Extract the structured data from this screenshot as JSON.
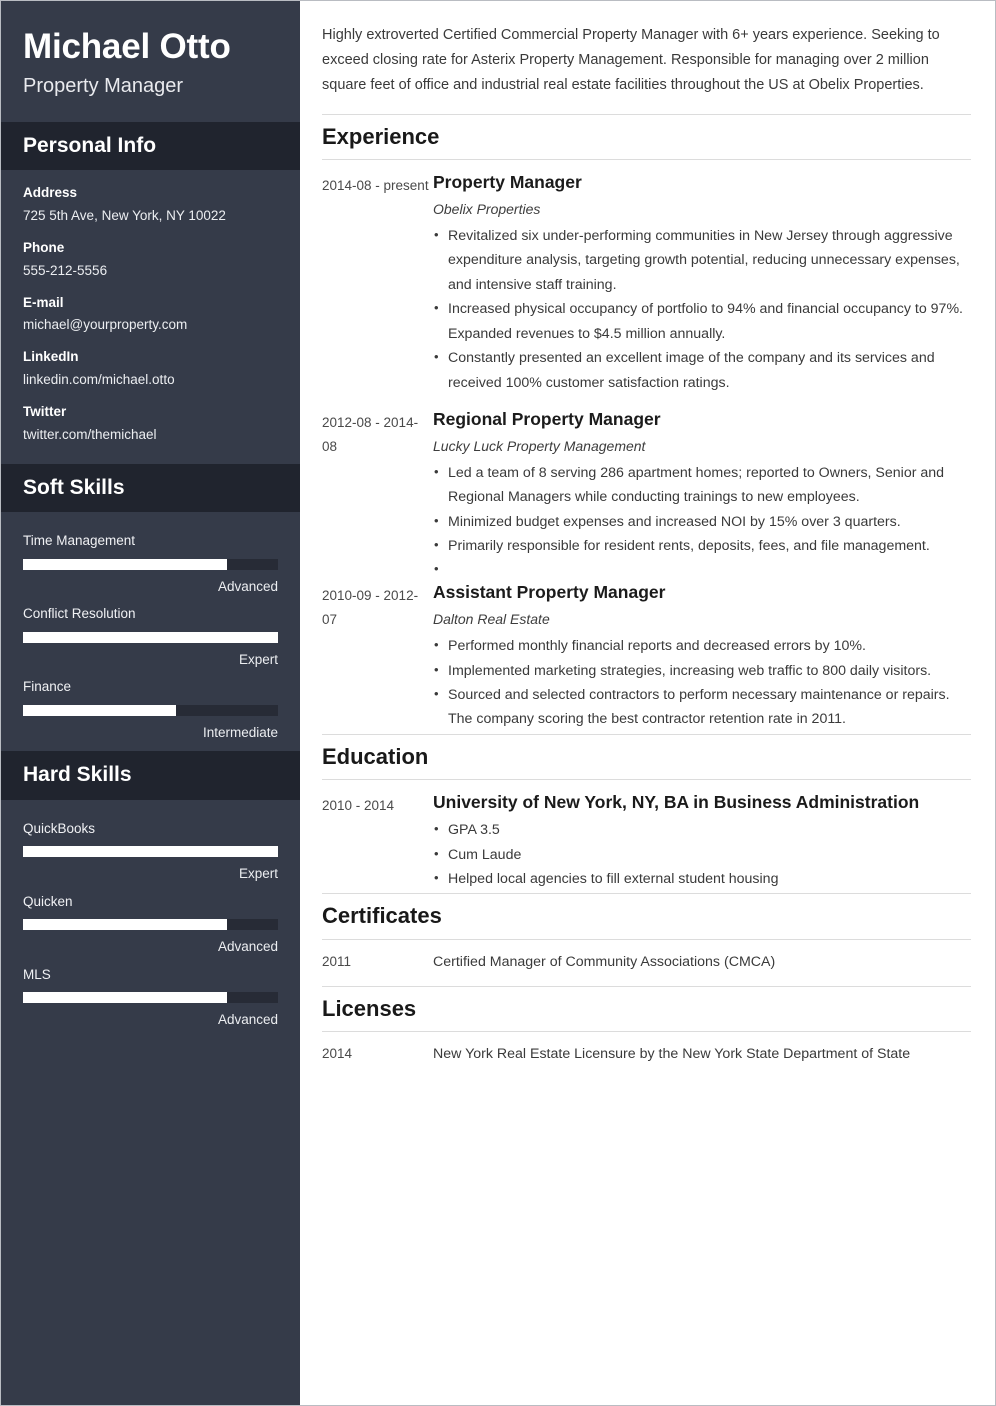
{
  "sidebar": {
    "full_name": "Michael Otto",
    "job_title": "Property Manager",
    "personal_info": {
      "heading": "Personal Info",
      "items": [
        {
          "label": "Address",
          "value": "725 5th Ave, New York, NY 10022"
        },
        {
          "label": "Phone",
          "value": "555-212-5556"
        },
        {
          "label": "E-mail",
          "value": "michael@yourproperty.com"
        },
        {
          "label": "LinkedIn",
          "value": "linkedin.com/michael.otto"
        },
        {
          "label": "Twitter",
          "value": "twitter.com/themichael"
        }
      ]
    },
    "soft_skills": {
      "heading": "Soft Skills",
      "items": [
        {
          "name": "Time Management",
          "level": "Advanced",
          "percent": 80
        },
        {
          "name": "Conflict Resolution",
          "level": "Expert",
          "percent": 100
        },
        {
          "name": "Finance",
          "level": "Intermediate",
          "percent": 60
        }
      ]
    },
    "hard_skills": {
      "heading": "Hard Skills",
      "items": [
        {
          "name": "QuickBooks",
          "level": "Expert",
          "percent": 100
        },
        {
          "name": "Quicken",
          "level": "Advanced",
          "percent": 80
        },
        {
          "name": "MLS",
          "level": "Advanced",
          "percent": 80
        }
      ]
    }
  },
  "main": {
    "summary": "Highly extroverted Certified Commercial Property Manager with 6+ years experience. Seeking to exceed closing rate for Asterix Property Management. Responsible for managing over 2 million square feet of office and industrial real estate facilities throughout the US at Obelix Properties.",
    "experience": {
      "heading": "Experience",
      "entries": [
        {
          "date": "2014-08 - present",
          "title": "Property Manager",
          "company": "Obelix Properties",
          "bullets": [
            "Revitalized six under-performing communities in New Jersey through aggressive expenditure analysis, targeting growth potential, reducing unnecessary expenses, and intensive staff training.",
            "Increased physical occupancy of portfolio to 94% and financial occupancy to 97%. Expanded revenues to $4.5 million annually.",
            "Constantly presented an excellent image of the company and its services and received 100% customer satisfaction ratings."
          ]
        },
        {
          "date": "2012-08 - 2014-08",
          "title": "Regional Property Manager",
          "company": "Lucky Luck Property Management",
          "bullets": [
            "Led a team of 8 serving 286 apartment homes; reported to Owners, Senior and Regional Managers while conducting trainings to new employees.",
            "Minimized budget expenses and increased NOI by 15% over 3 quarters.",
            "Primarily responsible for resident rents, deposits, fees, and file management.",
            ""
          ]
        },
        {
          "date": "2010-09 - 2012-07",
          "title": "Assistant Property Manager",
          "company": "Dalton Real Estate",
          "bullets": [
            "Performed monthly financial reports and decreased errors by 10%.",
            "Implemented marketing strategies, increasing web traffic to 800 daily visitors.",
            "Sourced and selected contractors to perform necessary maintenance or repairs. The company scoring the best contractor retention rate in 2011."
          ]
        }
      ]
    },
    "education": {
      "heading": "Education",
      "entries": [
        {
          "date": "2010 - 2014",
          "title": "University of New York, NY, BA in Business Administration",
          "bullets": [
            "GPA 3.5",
            "Cum Laude",
            "Helped local agencies to fill external student housing"
          ]
        }
      ]
    },
    "certificates": {
      "heading": "Certificates",
      "entries": [
        {
          "date": "2011",
          "text": "Certified Manager of Community Associations (CMCA)"
        }
      ]
    },
    "licenses": {
      "heading": "Licenses",
      "entries": [
        {
          "date": "2014",
          "text": "New York Real Estate Licensure by the New York State Department of State"
        }
      ]
    }
  },
  "colors": {
    "sidebar_bg": "#353b49",
    "sidebar_band_bg": "#20242e",
    "bar_track": "#272b36",
    "bar_fill": "#ffffff",
    "rule": "#dcdcdc"
  }
}
